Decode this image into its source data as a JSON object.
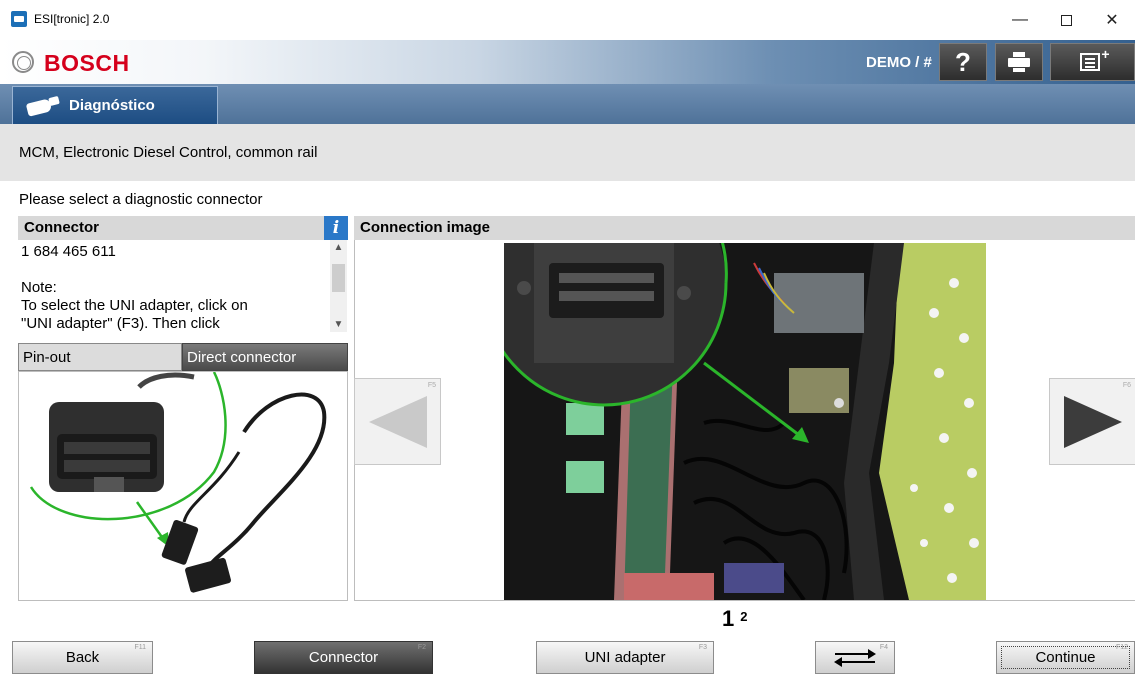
{
  "window": {
    "title": "ESI[tronic] 2.0",
    "minimize": "—",
    "close": "✕"
  },
  "header": {
    "brand": "BOSCH",
    "demo_label": "DEMO / #",
    "help_label": "?"
  },
  "nav": {
    "tab_label": "Diagnóstico"
  },
  "page": {
    "subtitle": "MCM, Electronic Diesel Control, common rail",
    "prompt": "Please select a diagnostic connector"
  },
  "connector_panel": {
    "heading": "Connector",
    "info_label": "i",
    "part_number": "1 684 465 611",
    "note_title": "Note:",
    "note_line1": "To select the UNI adapter, click  on",
    "note_line2": "\"UNI adapter\" (F3). Then click",
    "tab_pinout": "Pin-out",
    "tab_direct": "Direct connector"
  },
  "image_panel": {
    "heading": "Connection image",
    "prev_key": "F5",
    "next_key": "F6",
    "page_current": "1",
    "page_next": "2"
  },
  "buttons": {
    "back": "Back",
    "back_key": "F11",
    "connector": "Connector",
    "connector_key": "F2",
    "uni": "UNI adapter",
    "uni_key": "F3",
    "swap_key": "F4",
    "continue": "Continue",
    "continue_key": "F12"
  },
  "colors": {
    "brand_red": "#d5001c",
    "nav_blue": "#1d4d83",
    "highlight_green": "#2bb52b"
  }
}
